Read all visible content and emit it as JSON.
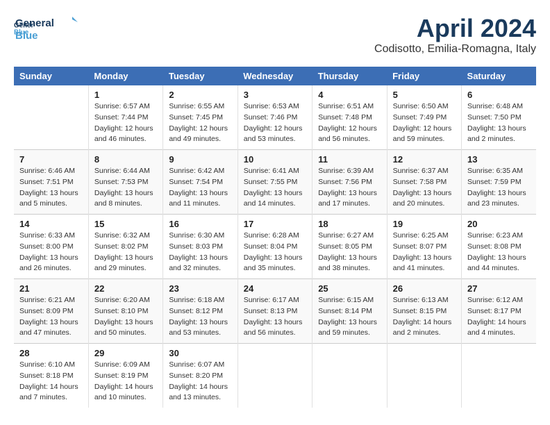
{
  "header": {
    "logo_line1": "General",
    "logo_line2": "Blue",
    "title": "April 2024",
    "subtitle": "Codisotto, Emilia-Romagna, Italy"
  },
  "days_of_week": [
    "Sunday",
    "Monday",
    "Tuesday",
    "Wednesday",
    "Thursday",
    "Friday",
    "Saturday"
  ],
  "weeks": [
    [
      {
        "day": "",
        "sunrise": "",
        "sunset": "",
        "daylight": ""
      },
      {
        "day": "1",
        "sunrise": "Sunrise: 6:57 AM",
        "sunset": "Sunset: 7:44 PM",
        "daylight": "Daylight: 12 hours and 46 minutes."
      },
      {
        "day": "2",
        "sunrise": "Sunrise: 6:55 AM",
        "sunset": "Sunset: 7:45 PM",
        "daylight": "Daylight: 12 hours and 49 minutes."
      },
      {
        "day": "3",
        "sunrise": "Sunrise: 6:53 AM",
        "sunset": "Sunset: 7:46 PM",
        "daylight": "Daylight: 12 hours and 53 minutes."
      },
      {
        "day": "4",
        "sunrise": "Sunrise: 6:51 AM",
        "sunset": "Sunset: 7:48 PM",
        "daylight": "Daylight: 12 hours and 56 minutes."
      },
      {
        "day": "5",
        "sunrise": "Sunrise: 6:50 AM",
        "sunset": "Sunset: 7:49 PM",
        "daylight": "Daylight: 12 hours and 59 minutes."
      },
      {
        "day": "6",
        "sunrise": "Sunrise: 6:48 AM",
        "sunset": "Sunset: 7:50 PM",
        "daylight": "Daylight: 13 hours and 2 minutes."
      }
    ],
    [
      {
        "day": "7",
        "sunrise": "Sunrise: 6:46 AM",
        "sunset": "Sunset: 7:51 PM",
        "daylight": "Daylight: 13 hours and 5 minutes."
      },
      {
        "day": "8",
        "sunrise": "Sunrise: 6:44 AM",
        "sunset": "Sunset: 7:53 PM",
        "daylight": "Daylight: 13 hours and 8 minutes."
      },
      {
        "day": "9",
        "sunrise": "Sunrise: 6:42 AM",
        "sunset": "Sunset: 7:54 PM",
        "daylight": "Daylight: 13 hours and 11 minutes."
      },
      {
        "day": "10",
        "sunrise": "Sunrise: 6:41 AM",
        "sunset": "Sunset: 7:55 PM",
        "daylight": "Daylight: 13 hours and 14 minutes."
      },
      {
        "day": "11",
        "sunrise": "Sunrise: 6:39 AM",
        "sunset": "Sunset: 7:56 PM",
        "daylight": "Daylight: 13 hours and 17 minutes."
      },
      {
        "day": "12",
        "sunrise": "Sunrise: 6:37 AM",
        "sunset": "Sunset: 7:58 PM",
        "daylight": "Daylight: 13 hours and 20 minutes."
      },
      {
        "day": "13",
        "sunrise": "Sunrise: 6:35 AM",
        "sunset": "Sunset: 7:59 PM",
        "daylight": "Daylight: 13 hours and 23 minutes."
      }
    ],
    [
      {
        "day": "14",
        "sunrise": "Sunrise: 6:33 AM",
        "sunset": "Sunset: 8:00 PM",
        "daylight": "Daylight: 13 hours and 26 minutes."
      },
      {
        "day": "15",
        "sunrise": "Sunrise: 6:32 AM",
        "sunset": "Sunset: 8:02 PM",
        "daylight": "Daylight: 13 hours and 29 minutes."
      },
      {
        "day": "16",
        "sunrise": "Sunrise: 6:30 AM",
        "sunset": "Sunset: 8:03 PM",
        "daylight": "Daylight: 13 hours and 32 minutes."
      },
      {
        "day": "17",
        "sunrise": "Sunrise: 6:28 AM",
        "sunset": "Sunset: 8:04 PM",
        "daylight": "Daylight: 13 hours and 35 minutes."
      },
      {
        "day": "18",
        "sunrise": "Sunrise: 6:27 AM",
        "sunset": "Sunset: 8:05 PM",
        "daylight": "Daylight: 13 hours and 38 minutes."
      },
      {
        "day": "19",
        "sunrise": "Sunrise: 6:25 AM",
        "sunset": "Sunset: 8:07 PM",
        "daylight": "Daylight: 13 hours and 41 minutes."
      },
      {
        "day": "20",
        "sunrise": "Sunrise: 6:23 AM",
        "sunset": "Sunset: 8:08 PM",
        "daylight": "Daylight: 13 hours and 44 minutes."
      }
    ],
    [
      {
        "day": "21",
        "sunrise": "Sunrise: 6:21 AM",
        "sunset": "Sunset: 8:09 PM",
        "daylight": "Daylight: 13 hours and 47 minutes."
      },
      {
        "day": "22",
        "sunrise": "Sunrise: 6:20 AM",
        "sunset": "Sunset: 8:10 PM",
        "daylight": "Daylight: 13 hours and 50 minutes."
      },
      {
        "day": "23",
        "sunrise": "Sunrise: 6:18 AM",
        "sunset": "Sunset: 8:12 PM",
        "daylight": "Daylight: 13 hours and 53 minutes."
      },
      {
        "day": "24",
        "sunrise": "Sunrise: 6:17 AM",
        "sunset": "Sunset: 8:13 PM",
        "daylight": "Daylight: 13 hours and 56 minutes."
      },
      {
        "day": "25",
        "sunrise": "Sunrise: 6:15 AM",
        "sunset": "Sunset: 8:14 PM",
        "daylight": "Daylight: 13 hours and 59 minutes."
      },
      {
        "day": "26",
        "sunrise": "Sunrise: 6:13 AM",
        "sunset": "Sunset: 8:15 PM",
        "daylight": "Daylight: 14 hours and 2 minutes."
      },
      {
        "day": "27",
        "sunrise": "Sunrise: 6:12 AM",
        "sunset": "Sunset: 8:17 PM",
        "daylight": "Daylight: 14 hours and 4 minutes."
      }
    ],
    [
      {
        "day": "28",
        "sunrise": "Sunrise: 6:10 AM",
        "sunset": "Sunset: 8:18 PM",
        "daylight": "Daylight: 14 hours and 7 minutes."
      },
      {
        "day": "29",
        "sunrise": "Sunrise: 6:09 AM",
        "sunset": "Sunset: 8:19 PM",
        "daylight": "Daylight: 14 hours and 10 minutes."
      },
      {
        "day": "30",
        "sunrise": "Sunrise: 6:07 AM",
        "sunset": "Sunset: 8:20 PM",
        "daylight": "Daylight: 14 hours and 13 minutes."
      },
      {
        "day": "",
        "sunrise": "",
        "sunset": "",
        "daylight": ""
      },
      {
        "day": "",
        "sunrise": "",
        "sunset": "",
        "daylight": ""
      },
      {
        "day": "",
        "sunrise": "",
        "sunset": "",
        "daylight": ""
      },
      {
        "day": "",
        "sunrise": "",
        "sunset": "",
        "daylight": ""
      }
    ]
  ]
}
